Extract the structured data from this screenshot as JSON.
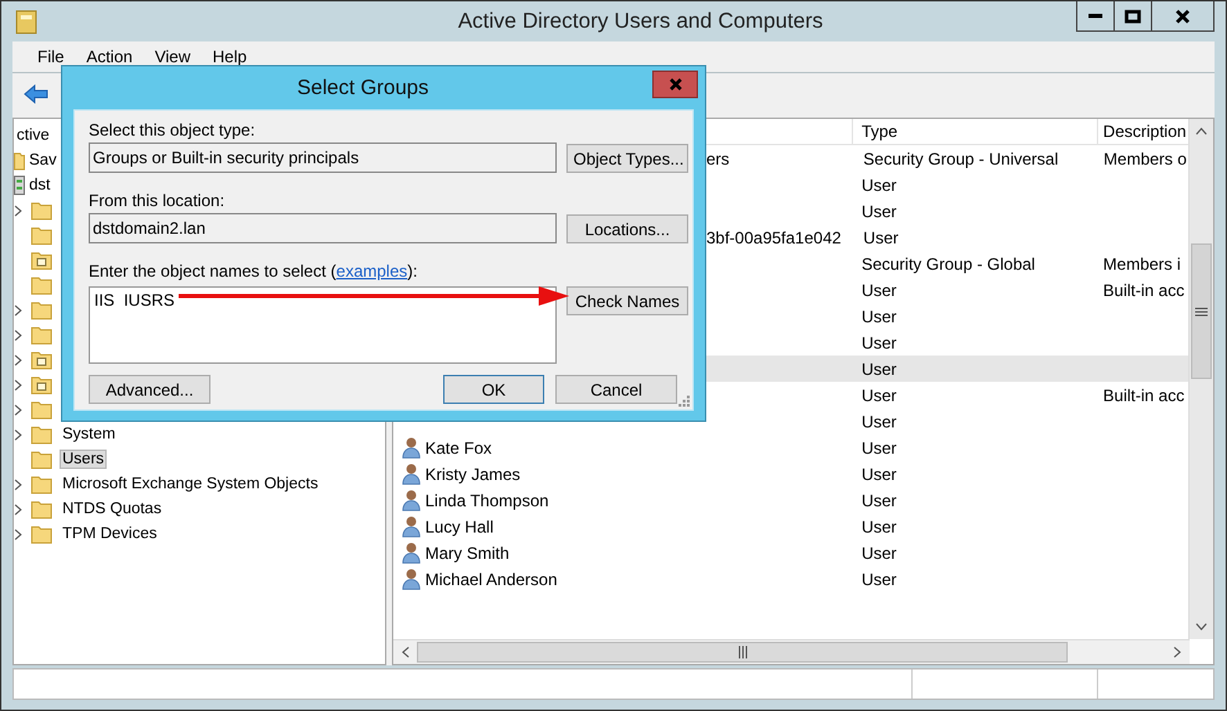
{
  "window": {
    "title": "Active Directory Users and Computers"
  },
  "menu": [
    "File",
    "Action",
    "View",
    "Help"
  ],
  "tree": [
    {
      "label": "ctive",
      "selected": false,
      "children": [
        {
          "label": "Sav",
          "kind": "saved",
          "selected": false
        },
        {
          "label": "dst",
          "kind": "domain",
          "selected": false,
          "children": [
            {
              "kind": "folder",
              "expandable": true
            },
            {
              "kind": "folder",
              "expandable": false
            },
            {
              "kind": "ou",
              "expandable": false
            },
            {
              "kind": "folder",
              "expandable": false
            },
            {
              "kind": "folder",
              "expandable": true
            },
            {
              "kind": "folder",
              "expandable": true
            },
            {
              "kind": "ou",
              "expandable": true
            },
            {
              "kind": "ou",
              "expandable": true
            },
            {
              "kind": "folder",
              "expandable": true
            },
            {
              "label": "System",
              "kind": "folder",
              "expandable": true,
              "selected": false
            },
            {
              "label": "Users",
              "kind": "folder",
              "expandable": false,
              "selected": true
            },
            {
              "label": "Microsoft Exchange System Objects",
              "kind": "folder",
              "expandable": true,
              "selected": false
            },
            {
              "label": "NTDS Quotas",
              "kind": "folder",
              "expandable": true,
              "selected": false
            },
            {
              "label": "TPM Devices",
              "kind": "folder",
              "expandable": true,
              "selected": false
            }
          ]
        }
      ]
    }
  ],
  "list": {
    "columns": [
      "Type",
      "Description"
    ],
    "rows": [
      {
        "name": "ers",
        "name_clipped": true,
        "type": "Security Group - Universal",
        "description": "Members o",
        "selected": false
      },
      {
        "type": "User",
        "selected": false
      },
      {
        "type": "User",
        "selected": false
      },
      {
        "name": "3bf-00a95fa1e042",
        "name_clipped": true,
        "type": "User",
        "selected": false
      },
      {
        "type": "Security Group - Global",
        "description": "Members i",
        "selected": false
      },
      {
        "type": "User",
        "description": "Built-in acc",
        "selected": false
      },
      {
        "type": "User",
        "selected": false
      },
      {
        "type": "User",
        "selected": false
      },
      {
        "type": "User",
        "selected": true
      },
      {
        "type": "User",
        "description": "Built-in acc",
        "selected": false
      },
      {
        "type": "User",
        "selected": false
      },
      {
        "kind": "user",
        "name": "Kate Fox",
        "name_clipped": false,
        "type": "User",
        "selected": false
      },
      {
        "kind": "user",
        "name": "Kristy James",
        "name_clipped": false,
        "type": "User",
        "selected": false
      },
      {
        "kind": "user",
        "name": "Linda Thompson",
        "name_clipped": false,
        "type": "User",
        "selected": false
      },
      {
        "kind": "user",
        "name": "Lucy  Hall",
        "name_clipped": false,
        "type": "User",
        "selected": false
      },
      {
        "kind": "user",
        "name": "Mary Smith",
        "name_clipped": false,
        "type": "User",
        "selected": false
      },
      {
        "kind": "user",
        "name": "Michael Anderson",
        "name_clipped": false,
        "type": "User",
        "selected": false
      }
    ]
  },
  "dialog": {
    "title": "Select Groups",
    "object_type_label": "Select this object type:",
    "object_type": "Groups or Built-in security principals",
    "object_types_button": "Object Types...",
    "location_label": "From this location:",
    "location": "dstdomain2.lan",
    "locations_button": "Locations...",
    "names_label": "Enter the object names to select (",
    "names_link": "examples",
    "names_label_end": "):",
    "names_value": "IIS  IUSRS",
    "check_names_button": "Check Names",
    "advanced_button": "Advanced...",
    "ok_button": "OK",
    "cancel_button": "Cancel",
    "annotations": [
      {
        "kind": "arrow"
      }
    ]
  }
}
